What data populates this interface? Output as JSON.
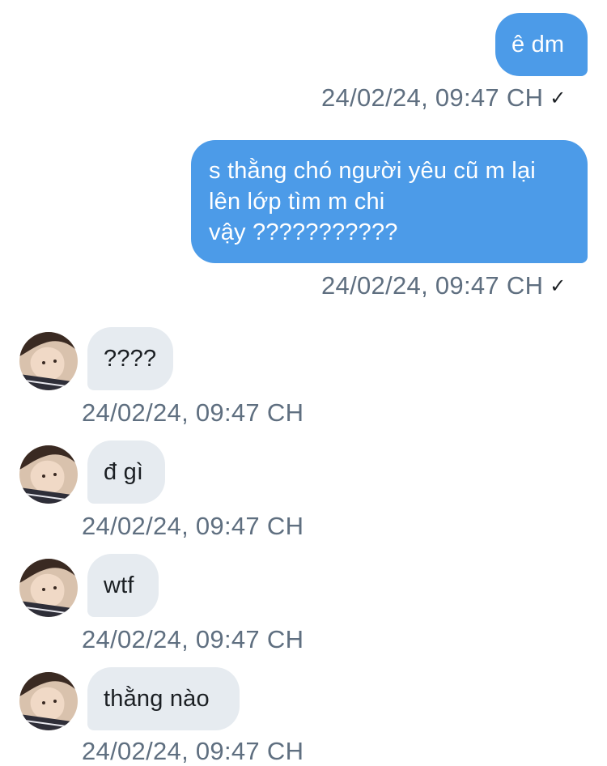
{
  "sent_messages": [
    {
      "text": "ê dm",
      "time": "24/02/24, 09:47 CH",
      "status": "read-check"
    },
    {
      "text": "s thằng chó người yêu cũ m lại\nlên lớp tìm m chi\nvậy ???????????",
      "time": "24/02/24, 09:47 CH",
      "status": "read-check"
    }
  ],
  "received_messages": [
    {
      "text": "????",
      "time": "24/02/24, 09:47 CH"
    },
    {
      "text": "đ gì",
      "time": "24/02/24, 09:47 CH"
    },
    {
      "text": "wtf",
      "time": "24/02/24, 09:47 CH"
    },
    {
      "text": "thằng nào",
      "time": "24/02/24, 09:47 CH"
    }
  ],
  "check_glyph": "✓",
  "colors": {
    "sent_bubble": "#4c9be8",
    "received_bubble": "#e6ebf0",
    "timestamp": "#5f6f80"
  }
}
